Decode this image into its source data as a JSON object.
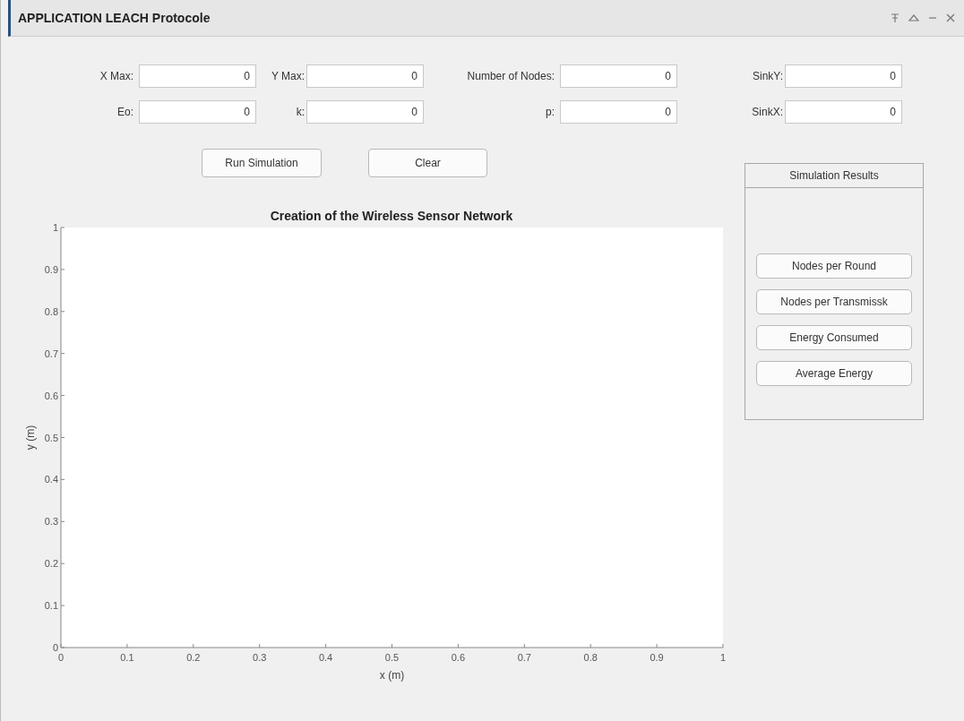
{
  "window": {
    "title": "APPLICATION LEACH Protocole"
  },
  "fields": [
    {
      "label": "X Max:",
      "value": "0"
    },
    {
      "label": "Y Max:",
      "value": "0"
    },
    {
      "label": "Number of Nodes:",
      "value": "0"
    },
    {
      "label": "SinkY:",
      "value": "0"
    },
    {
      "label": "Eo:",
      "value": "0"
    },
    {
      "label": "k:",
      "value": "0"
    },
    {
      "label": "p:",
      "value": "0"
    },
    {
      "label": "SinkX:",
      "value": "0"
    }
  ],
  "buttons": [
    "Run Simulation",
    "Clear"
  ],
  "chart": {
    "chart_data": {
      "type": "scatter",
      "title": "Creation of the Wireless Sensor Network",
      "xlabel": "x (m)",
      "ylabel": "y (m)",
      "xlim": [
        0,
        1
      ],
      "ylim": [
        0,
        1
      ],
      "xticks": [
        0,
        0.1,
        0.2,
        0.3,
        0.4,
        0.5,
        0.6,
        0.7,
        0.8,
        0.9,
        1
      ],
      "yticks": [
        0,
        0.1,
        0.2,
        0.3,
        0.4,
        0.5,
        0.6,
        0.7,
        0.8,
        0.9,
        1
      ]
    }
  },
  "results_panel": {
    "title": "Simulation Results",
    "buttons": [
      "Nodes per Round",
      "Nodes per Transmissk",
      "Energy Consumed",
      "Average Energy"
    ]
  }
}
